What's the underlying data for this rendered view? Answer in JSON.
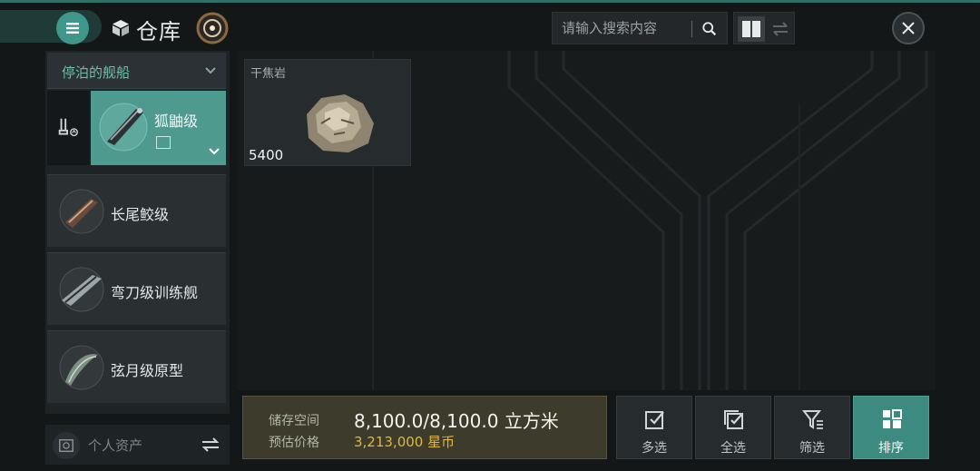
{
  "header": {
    "title": "仓库",
    "search_placeholder": "请输入搜索内容",
    "icons": [
      "menu-icon",
      "cube-icon",
      "badge-icon",
      "search-icon",
      "grid-icon",
      "swap-icon",
      "close-icon"
    ]
  },
  "sidebar": {
    "dropdown_label": "停泊的舰船",
    "ships": [
      {
        "name": "狐鼬级",
        "active": true
      },
      {
        "name": "长尾鲛级",
        "active": false
      },
      {
        "name": "弯刀级训练舰",
        "active": false
      },
      {
        "name": "弦月级原型",
        "active": false
      }
    ],
    "assets_label": "个人资产"
  },
  "items": [
    {
      "name": "干焦岩",
      "quantity": "5400"
    }
  ],
  "info": {
    "storage_label": "储存空间",
    "storage_value": "8,100.0/8,100.0 立方米",
    "price_label": "预估价格",
    "price_value": "3,213,000 星币"
  },
  "actions": {
    "multi_select": "多选",
    "select_all": "全选",
    "filter": "筛选",
    "sort": "排序"
  },
  "colors": {
    "accent": "#4f9a8f",
    "gold": "#e0b83c",
    "background": "#141718"
  }
}
